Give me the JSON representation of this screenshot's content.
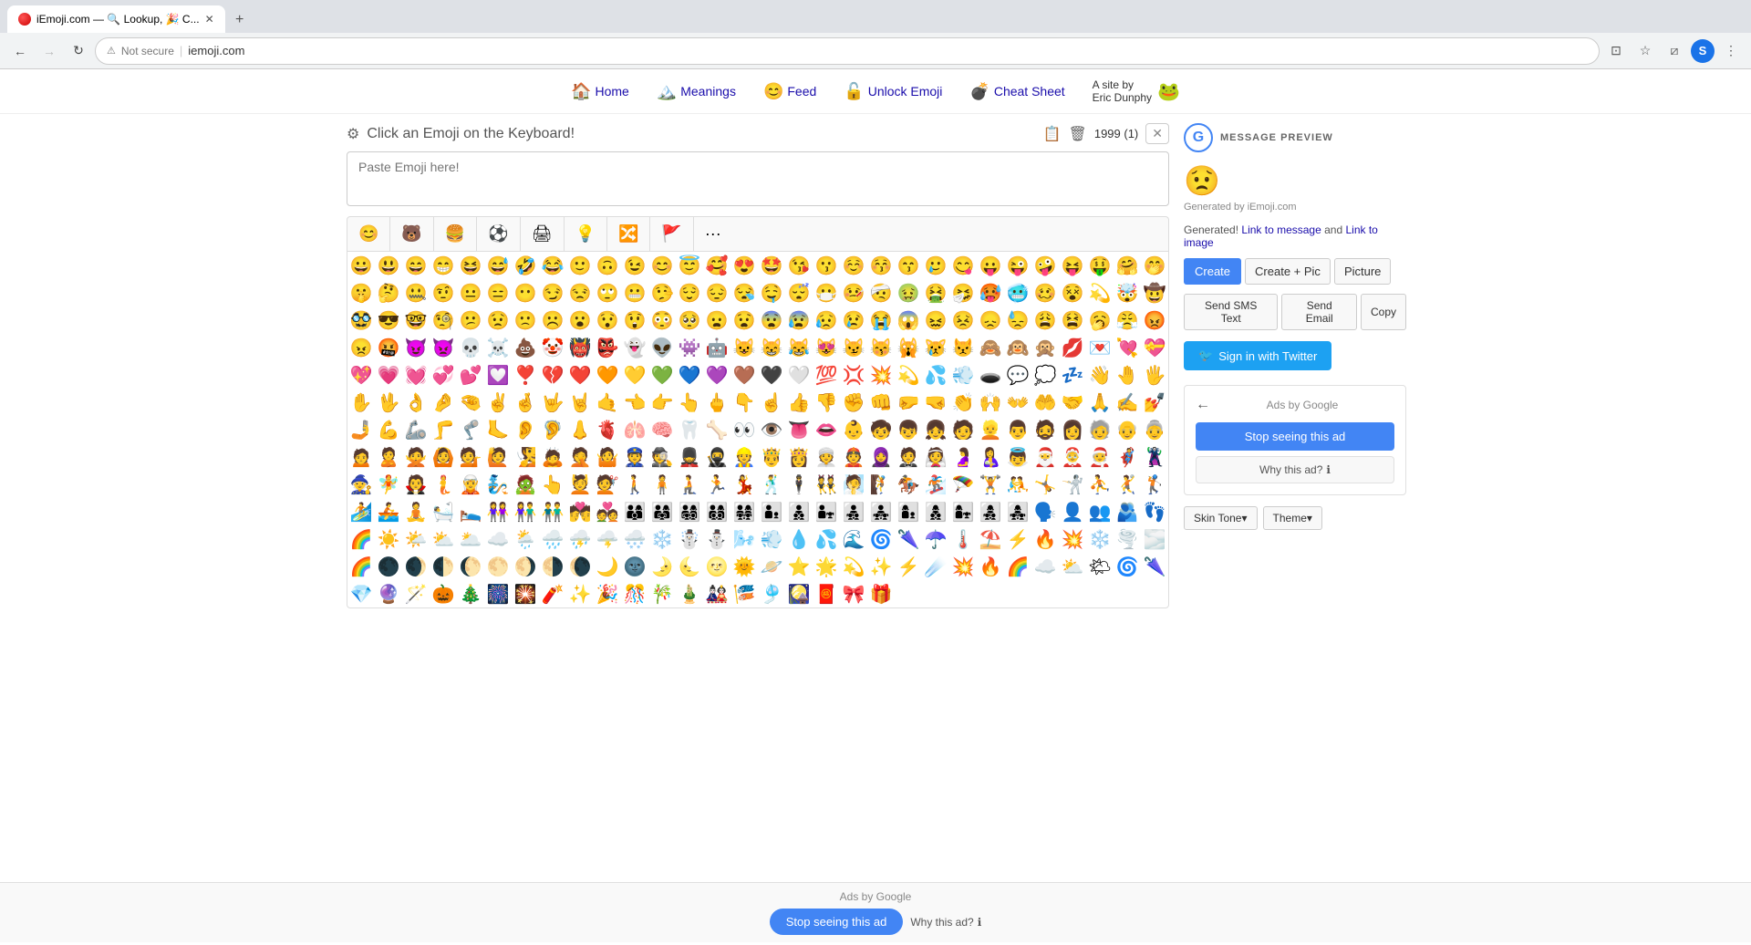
{
  "browser": {
    "tabs": [
      {
        "id": "tab-emoji",
        "title": "iEmoji.com — 🔍 Lookup, 🎉 C...",
        "favicon_color": "#e74c3c",
        "active": true
      }
    ],
    "new_tab_label": "+",
    "nav": {
      "back_disabled": false,
      "forward_disabled": true,
      "reload_label": "↻",
      "security": "Not secure",
      "url": "iemoji.com"
    }
  },
  "site_nav": {
    "items": [
      {
        "label": "Home",
        "icon": "🏠"
      },
      {
        "label": "Meanings",
        "icon": "🏔️"
      },
      {
        "label": "Feed",
        "icon": "😊"
      },
      {
        "label": "Unlock Emoji",
        "icon": "🔓"
      },
      {
        "label": "Cheat Sheet",
        "icon": "💣"
      }
    ],
    "site_by": "A site by\nEric Dunphy",
    "site_icon": "🐸"
  },
  "picker": {
    "header_text": "Click an Emoji on the Keyboard!",
    "gear_icon": "⚙",
    "paste_placeholder": "Paste Emoji here!",
    "count": "1999 (1)",
    "copy_icon": "📋",
    "trash_icon": "🗑",
    "close_icon": "✕",
    "category_tabs": [
      {
        "icon": "😊",
        "label": "smileys"
      },
      {
        "icon": "🐻",
        "label": "animals"
      },
      {
        "icon": "🍔",
        "label": "food"
      },
      {
        "icon": "⚽",
        "label": "activities"
      },
      {
        "icon": "🖨",
        "label": "objects"
      },
      {
        "icon": "💡",
        "label": "symbols"
      },
      {
        "icon": "🔀",
        "label": "travel"
      },
      {
        "icon": "🚩",
        "label": "flags"
      },
      {
        "icon": "···",
        "label": "more"
      }
    ],
    "emojis": [
      "😀",
      "😃",
      "😄",
      "😁",
      "😆",
      "😅",
      "🤣",
      "😂",
      "🙂",
      "🙃",
      "😉",
      "😊",
      "😇",
      "🥰",
      "😍",
      "🤩",
      "😘",
      "😗",
      "☺️",
      "😚",
      "😙",
      "🥲",
      "😋",
      "😛",
      "😜",
      "🤪",
      "😝",
      "🤑",
      "🤗",
      "🤭",
      "🤫",
      "🤔",
      "🤐",
      "🤨",
      "😐",
      "😑",
      "😶",
      "😏",
      "😒",
      "🙄",
      "😬",
      "🤥",
      "😌",
      "😔",
      "😪",
      "🤤",
      "😴",
      "😷",
      "🤒",
      "🤕",
      "🤢",
      "🤮",
      "🤧",
      "🥵",
      "🥶",
      "🥴",
      "😵",
      "💫",
      "🤯",
      "🤠",
      "🥸",
      "😎",
      "🤓",
      "🧐",
      "😕",
      "😟",
      "🙁",
      "☹️",
      "😮",
      "😯",
      "😲",
      "😳",
      "🥺",
      "😦",
      "😧",
      "😨",
      "😰",
      "😥",
      "😢",
      "😭",
      "😱",
      "😖",
      "😣",
      "😞",
      "😓",
      "😩",
      "😫",
      "🥱",
      "😤",
      "😡",
      "😠",
      "🤬",
      "😈",
      "👿",
      "💀",
      "☠️",
      "💩",
      "🤡",
      "👹",
      "👺",
      "👻",
      "👽",
      "👾",
      "🤖",
      "😺",
      "😸",
      "😹",
      "😻",
      "😼",
      "😽",
      "🙀",
      "😿",
      "😾",
      "🙈",
      "🙉",
      "🙊",
      "💋",
      "💌",
      "💘",
      "💝",
      "💖",
      "💗",
      "💓",
      "💞",
      "💕",
      "💟",
      "❣️",
      "💔",
      "❤️",
      "🧡",
      "💛",
      "💚",
      "💙",
      "💜",
      "🤎",
      "🖤",
      "🤍",
      "💯",
      "💢",
      "💥",
      "💫",
      "💦",
      "💨",
      "🕳️",
      "💬",
      "💭",
      "💤",
      "👋",
      "🤚",
      "🖐️",
      "✋",
      "🖖",
      "👌",
      "🤌",
      "🤏",
      "✌️",
      "🤞",
      "🤟",
      "🤘",
      "🤙",
      "👈",
      "👉",
      "👆",
      "🖕",
      "👇",
      "☝️",
      "👍",
      "👎",
      "✊",
      "👊",
      "🤛",
      "🤜",
      "👏",
      "🙌",
      "👐",
      "🤲",
      "🤝",
      "🙏",
      "✍️",
      "💅",
      "🤳",
      "💪",
      "🦾",
      "🦵",
      "🦿",
      "🦶",
      "👂",
      "🦻",
      "👃",
      "🫀",
      "🫁",
      "🧠",
      "🦷",
      "🦴",
      "👀",
      "👁️",
      "👅",
      "👄",
      "👶",
      "🧒",
      "👦",
      "👧",
      "🧑",
      "👱",
      "👨",
      "🧔",
      "👩",
      "🧓",
      "👴",
      "👵",
      "🙍",
      "🙎",
      "🙅",
      "🙆",
      "💁",
      "🙋",
      "🧏",
      "🙇",
      "🤦",
      "🤷",
      "👮",
      "🕵️",
      "💂",
      "🥷",
      "👷",
      "🤴",
      "👸",
      "👳",
      "👲",
      "🧕",
      "🤵",
      "👰",
      "🤰",
      "🤱",
      "👼",
      "🎅",
      "🤶",
      "🧑‍🎄",
      "🦸",
      "🦹",
      "🧙",
      "🧚",
      "🧛",
      "🧜",
      "🧝",
      "🧞",
      "🧟",
      "👆",
      "💆",
      "💇",
      "🚶",
      "🧍",
      "🧎",
      "🏃",
      "💃",
      "🕺",
      "🕴️",
      "👯",
      "🧖",
      "🧗",
      "🏇",
      "🏂",
      "🪂",
      "🏋️",
      "🤼",
      "🤸",
      "🤺",
      "⛹️",
      "🤾",
      "🏌️",
      "🏄",
      "🚣",
      "🧘",
      "🛀",
      "🛌",
      "👭",
      "👫",
      "👬",
      "💏",
      "💑",
      "👨‍👩‍👦",
      "👨‍👩‍👧",
      "👨‍👩‍👧‍👦",
      "👨‍👩‍👦‍👦",
      "👨‍👩‍👧‍👧",
      "👨‍👦",
      "👨‍👦‍👦",
      "👨‍👧",
      "👨‍👧‍👦",
      "👨‍👧‍👧",
      "👩‍👦",
      "👩‍👦‍👦",
      "👩‍👧",
      "👩‍👧‍👦",
      "👩‍👧‍👧",
      "🗣️",
      "👤",
      "👥",
      "🫂",
      "👣",
      "🌈",
      "☀️",
      "🌤️",
      "⛅",
      "🌥️",
      "☁️",
      "🌦️",
      "🌧️",
      "⛈️",
      "🌩️",
      "🌨️",
      "❄️",
      "☃️",
      "⛄",
      "🌬️",
      "💨",
      "💧",
      "💦",
      "🌊",
      "🌀",
      "🌂",
      "☂️",
      "🌡️",
      "⛱️",
      "⚡",
      "🔥",
      "💥",
      "❄️",
      "🌪️",
      "🌫️",
      "🌈",
      "🌑",
      "🌒",
      "🌓",
      "🌔",
      "🌕",
      "🌖",
      "🌗",
      "🌘",
      "🌙",
      "🌚",
      "🌛",
      "🌜",
      "🌝",
      "🌞",
      "🪐",
      "⭐",
      "🌟",
      "💫",
      "✨",
      "⚡",
      "☄️",
      "💥",
      "🔥",
      "🌈",
      "☁️",
      "⛅",
      "🌤",
      "🌀",
      "🌂",
      "💎",
      "🔮",
      "🪄",
      "🎃",
      "🎄",
      "🎆",
      "🎇",
      "🧨",
      "✨",
      "🎉",
      "🎊",
      "🎋",
      "🎍",
      "🎎",
      "🎏",
      "🎐",
      "🎑",
      "🧧",
      "🎀",
      "🎁"
    ]
  },
  "message_panel": {
    "panel_title": "MESSAGE PREVIEW",
    "preview_emoji": "😟",
    "generated_by": "Generated by iEmoji.com",
    "generated_text": "Generated!",
    "link_to_message": "Link to message",
    "and_text": "and",
    "link_to_image": "Link to image",
    "btn_create": "Create",
    "btn_create_pic": "Create + Pic",
    "btn_picture": "Picture",
    "btn_sms": "Send SMS Text",
    "btn_email": "Send Email",
    "btn_copy": "Copy",
    "btn_twitter": "Sign in with Twitter",
    "ads_by_google": "Ads by Google",
    "btn_stop_ad": "Stop seeing this ad",
    "btn_why_ad": "Why this ad?",
    "btn_skin_tone": "Skin Tone▾",
    "btn_theme": "Theme▾"
  },
  "bottom_ad": {
    "ads_by_google": "Ads by Google",
    "btn_stop_ad": "Stop seeing this ad",
    "btn_why_ad": "Why this ad?",
    "info_icon": "ℹ"
  }
}
